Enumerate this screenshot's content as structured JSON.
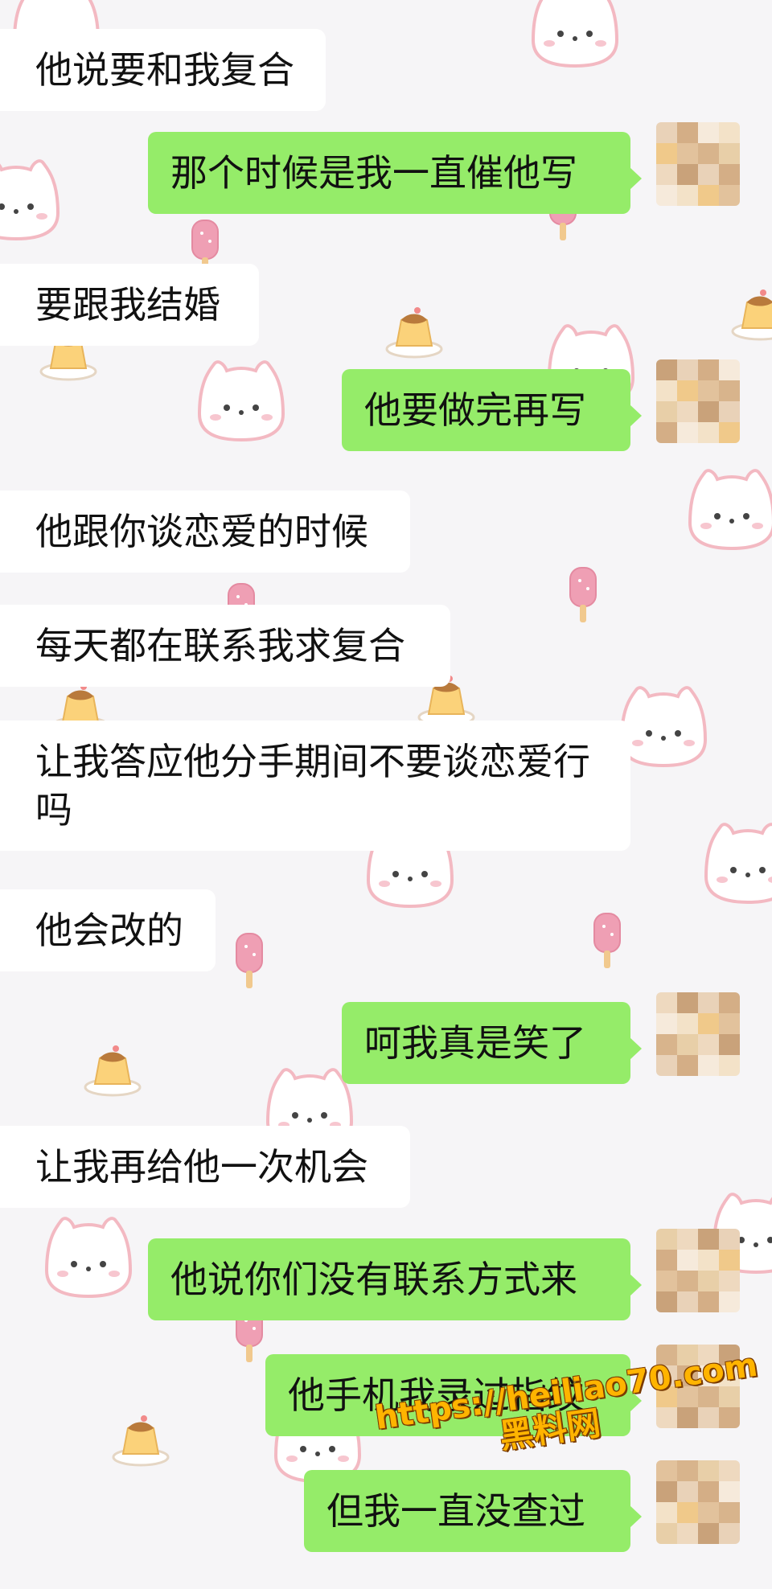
{
  "messages": [
    {
      "side": "in",
      "text": "他说要和我复合"
    },
    {
      "side": "out",
      "text": "那个时候是我一直催他写"
    },
    {
      "side": "in",
      "text": "要跟我结婚"
    },
    {
      "side": "out",
      "text": "他要做完再写"
    },
    {
      "side": "in",
      "text": "他跟你谈恋爱的时候"
    },
    {
      "side": "in",
      "text": "每天都在联系我求复合"
    },
    {
      "side": "in",
      "text": "让我答应他分手期间不要谈恋爱行吗"
    },
    {
      "side": "in",
      "text": "他会改的"
    },
    {
      "side": "out",
      "text": "呵我真是笑了"
    },
    {
      "side": "in",
      "text": "让我再给他一次机会"
    },
    {
      "side": "out",
      "text": "他说你们没有联系方式来"
    },
    {
      "side": "out",
      "text": "他手机我录过指纹"
    },
    {
      "side": "out",
      "text": "但我一直没查过"
    }
  ],
  "watermark": {
    "url": "https://heiliao70.com",
    "name": "黑料网"
  },
  "colors": {
    "outgoing_bubble": "#95ec69",
    "incoming_bubble": "#ffffff",
    "background": "#f6f5f7"
  }
}
